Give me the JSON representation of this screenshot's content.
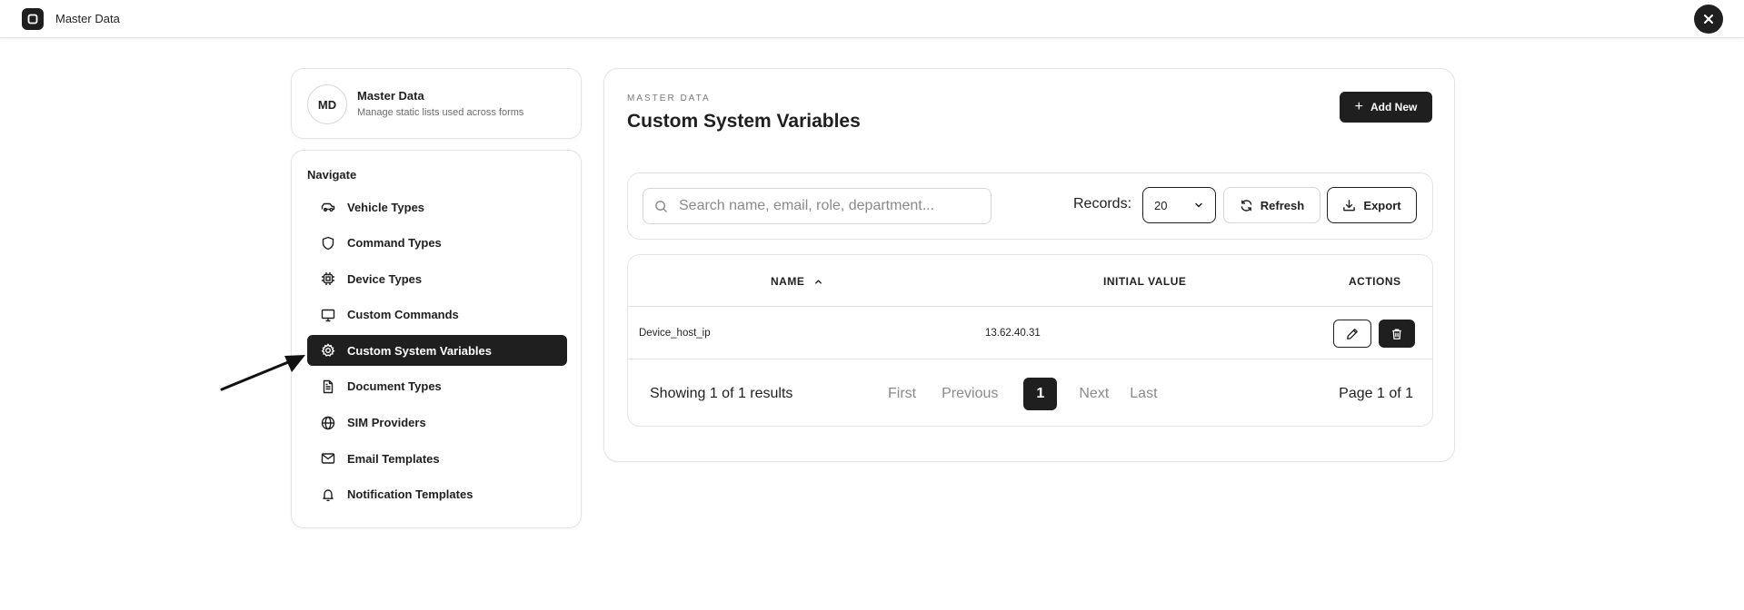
{
  "app": {
    "title": "Master Data"
  },
  "sidebar": {
    "avatar": "MD",
    "title": "Master Data",
    "subtitle": "Manage static lists used across forms",
    "nav_heading": "Navigate",
    "items": [
      {
        "label": "Vehicle Types",
        "icon": "car-icon"
      },
      {
        "label": "Command Types",
        "icon": "shield-icon"
      },
      {
        "label": "Device Types",
        "icon": "chip-icon"
      },
      {
        "label": "Custom Commands",
        "icon": "monitor-icon"
      },
      {
        "label": "Custom System Variables",
        "icon": "gear-icon",
        "active": true
      },
      {
        "label": "Document Types",
        "icon": "document-icon"
      },
      {
        "label": "SIM Providers",
        "icon": "globe-icon"
      },
      {
        "label": "Email Templates",
        "icon": "mail-icon"
      },
      {
        "label": "Notification Templates",
        "icon": "bell-icon"
      }
    ]
  },
  "main": {
    "eyebrow": "MASTER DATA",
    "title": "Custom System Variables",
    "add_label": "Add New",
    "search_placeholder": "Search name, email, role, department...",
    "records_label": "Records:",
    "records_value": "20",
    "refresh_label": "Refresh",
    "export_label": "Export",
    "table": {
      "columns": {
        "name": "NAME",
        "initial_value": "INITIAL VALUE",
        "actions": "ACTIONS"
      },
      "rows": [
        {
          "name": "Device_host_ip",
          "initial_value": "13.62.40.31"
        }
      ]
    },
    "pagination": {
      "showing": "Showing 1 of 1 results",
      "first": "First",
      "previous": "Previous",
      "current": "1",
      "next": "Next",
      "last": "Last",
      "page_of": "Page 1 of 1"
    }
  }
}
